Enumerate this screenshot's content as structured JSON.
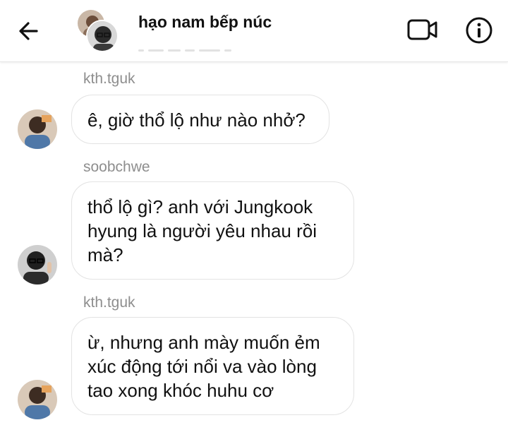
{
  "header": {
    "title": "hạo nam bếp núc",
    "back_icon": "arrow-left-icon",
    "video_icon": "video-call-icon",
    "info_icon": "info-icon"
  },
  "messages": [
    {
      "sender": "kth.tguk",
      "lines": [
        "ê, giờ thổ lộ như nào nhở?"
      ]
    },
    {
      "sender": "soobchwe",
      "lines": [
        "thổ lộ gì? anh với Jungkook",
        "hyung là người yêu nhau rồi",
        "mà?"
      ]
    },
    {
      "sender": "kth.tguk",
      "lines": [
        "ừ, nhưng anh mày muốn ẻm",
        "xúc động tới nổi va vào lòng",
        "tao xong khóc huhu cơ"
      ]
    }
  ]
}
